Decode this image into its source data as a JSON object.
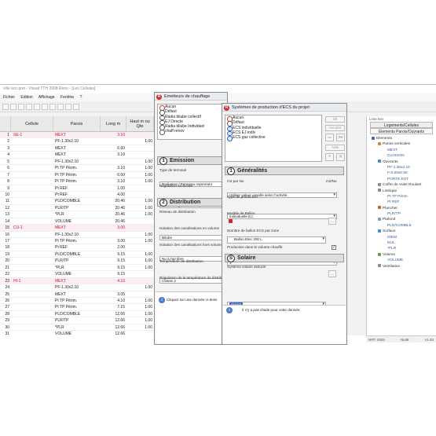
{
  "window": {
    "title": "ville eco.pret - Visual TTH 2008 Reno - [Les Cellules]"
  },
  "menu": [
    "Fichier",
    "Edition",
    "Affichage",
    "Fenêtre",
    "?"
  ],
  "grid": {
    "headers": {
      "cell": "Cellule",
      "wall": "Parois",
      "length": "Long m",
      "height": "Haut m ou Qte"
    },
    "rows": [
      {
        "num": "1",
        "cell": "SE-1",
        "wall": "MEXT",
        "len": "3.10",
        "h": "",
        "cellrow": true
      },
      {
        "num": "2",
        "cell": "",
        "wall": "PF-1.30x2.10",
        "len": "",
        "h": "1.00"
      },
      {
        "num": "3",
        "cell": "",
        "wall": "MEXT",
        "len": "6.60",
        "h": ""
      },
      {
        "num": "4",
        "cell": "",
        "wall": "MEXT",
        "len": "3.10",
        "h": ""
      },
      {
        "num": "5",
        "cell": "",
        "wall": "PF-1.30x2.10",
        "len": "",
        "h": "1.00"
      },
      {
        "num": "6",
        "cell": "",
        "wall": "Pt TP Périm.",
        "len": "3.10",
        "h": "1.00"
      },
      {
        "num": "7",
        "cell": "",
        "wall": "Pt TP Périm.",
        "len": "6.60",
        "h": "1.00"
      },
      {
        "num": "8",
        "cell": "",
        "wall": "Pt TP Périm.",
        "len": "3.10",
        "h": "1.00"
      },
      {
        "num": "9",
        "cell": "",
        "wall": "Pt REF",
        "len": "1.00",
        "h": ""
      },
      {
        "num": "10",
        "cell": "",
        "wall": "Pt REF",
        "len": "4.00",
        "h": ""
      },
      {
        "num": "11",
        "cell": "",
        "wall": "PLD/COMBLE",
        "len": "20.46",
        "h": "1.00"
      },
      {
        "num": "12",
        "cell": "",
        "wall": "PLR/TP",
        "len": "20.46",
        "h": "1.00"
      },
      {
        "num": "13",
        "cell": "",
        "wall": "*PLR",
        "len": "20.46",
        "h": "1.00"
      },
      {
        "num": "14",
        "cell": "",
        "wall": "VOLUME",
        "len": "20.46",
        "h": ""
      },
      {
        "num": "15",
        "cell": "CU-1",
        "wall": "MEXT",
        "len": "3.00",
        "h": "",
        "cellrow": true
      },
      {
        "num": "16",
        "cell": "",
        "wall": "PF-1.30x2.10",
        "len": "",
        "h": "1.00"
      },
      {
        "num": "17",
        "cell": "",
        "wall": "Pt TP Périm.",
        "len": "3.00",
        "h": "1.00"
      },
      {
        "num": "18",
        "cell": "",
        "wall": "Pt REF",
        "len": "2.00",
        "h": ""
      },
      {
        "num": "19",
        "cell": "",
        "wall": "PLD/COMBLE",
        "len": "9.15",
        "h": "1.00"
      },
      {
        "num": "20",
        "cell": "",
        "wall": "PLR/TP",
        "len": "9.15",
        "h": "1.00"
      },
      {
        "num": "21",
        "cell": "",
        "wall": "*PLR",
        "len": "9.15",
        "h": "1.00"
      },
      {
        "num": "22",
        "cell": "",
        "wall": "VOLUME",
        "len": "9.15",
        "h": ""
      },
      {
        "num": "23",
        "cell": "HI-1",
        "wall": "MEXT",
        "len": "4.10",
        "h": "",
        "cellrow": true
      },
      {
        "num": "24",
        "cell": "",
        "wall": "PF-1.30x2.10",
        "len": "",
        "h": "1.00"
      },
      {
        "num": "25",
        "cell": "",
        "wall": "MEXT",
        "len": "3.05",
        "h": ""
      },
      {
        "num": "26",
        "cell": "",
        "wall": "Pt TP Périm.",
        "len": "4.10",
        "h": "1.00"
      },
      {
        "num": "27",
        "cell": "",
        "wall": "Pt TP Périm.",
        "len": "7.15",
        "h": "1.00"
      },
      {
        "num": "28",
        "cell": "",
        "wall": "PLD/COMBLE",
        "len": "12.66",
        "h": "1.00"
      },
      {
        "num": "29",
        "cell": "",
        "wall": "PLR/TP",
        "len": "12.66",
        "h": "1.00"
      },
      {
        "num": "30",
        "cell": "",
        "wall": "*PLR",
        "len": "12.66",
        "h": "1.00"
      },
      {
        "num": "31",
        "cell": "",
        "wall": "VOLUME",
        "len": "12.66",
        "h": ""
      }
    ]
  },
  "emitters_dialog": {
    "title": "Emetteurs de chauffage",
    "list": [
      "Aucun",
      "Défaut",
      "Radia bliube collectif",
      "EJ Directe",
      "Radia bliube Individuel",
      "chaff renov"
    ],
    "emission": {
      "number": "1",
      "title": "Emission",
      "type_label": "Type de terminal",
      "type_value": "Radiateur / Panneau rayonnant",
      "reg_label": "Régulation terminale",
      "reg_value": "Aucune régulation terminale"
    },
    "distribution": {
      "number": "2",
      "title": "Distribution",
      "network_label": "Réseau de distribution",
      "network_value": "Bitube",
      "iso_vol_label": "Isolation des canalisations en volume",
      "iso_vol_value": "Nu à l'air libre",
      "iso_hv_label": "Isolation des canalisations hors volume",
      "iso_hv_value": "Classe 2",
      "temp_label": "Température de distribution",
      "temp_value": "Haute (traditionnel)",
      "reg_temp_label": "Régulation de la température de distribution",
      "reg_temp_value": "Régulation en fonction de la température"
    },
    "info": "Cliquez sur une donnée ci-dess"
  },
  "ecs_dialog": {
    "title": "Systèmes de production d'ECS du projet",
    "list": [
      "Aucun",
      "Défaut",
      "ECS individuelle",
      "ECS EJ indiv",
      "ECS gaz collective"
    ],
    "buttons": {
      "ok": "Ok",
      "cancel": "Annuler",
      "help": "Aide",
      "forward": ">>",
      "add": "+",
      "delete": "✕"
    },
    "generalites": {
      "number": "1",
      "title": "Généralités",
      "m2_label": "m2 par Nu",
      "m2_right": "m2/Nu",
      "m2_value": "Utiliser valeur unsolle selon l'activité",
      "prod_label": "Type de production",
      "prod_value": "Individuelle EJ",
      "model_label": "Modèle de Ballon",
      "model_value": "Ballon Elec 200 L",
      "nb_label": "Nombre de ballon ECS par zone",
      "nb_value": "1",
      "vol_label": "Production dans le volume chauffé",
      "vol_check": "✓"
    },
    "solaire": {
      "number": "S",
      "title": "Solaire",
      "sys_label": "Système solaire associé",
      "sys_value": "Aucun"
    },
    "info": "Il n'y a pas d'aide pour cette donnée."
  },
  "right_panel": {
    "title": "Liste Bar",
    "tab1": "Logements/Cellules",
    "tab2": "Elements Parois/Ouvrants",
    "tree": [
      {
        "label": "Elements",
        "level": 1,
        "color": "#3b67b5"
      },
      {
        "label": "Parois verticales",
        "level": 2,
        "color": "#d08a2a"
      },
      {
        "label": "MEXT",
        "level": 3,
        "color": ""
      },
      {
        "label": "CLOISON",
        "level": 3,
        "color": ""
      },
      {
        "label": "Ouvrants",
        "level": 2,
        "color": "#3b8fd0"
      },
      {
        "label": "PF-1.30x2.10",
        "level": 3,
        "color": ""
      },
      {
        "label": "F-0.50x0.50",
        "level": 3,
        "color": ""
      },
      {
        "label": "PORTE EXT",
        "level": 3,
        "color": ""
      },
      {
        "label": "Coffre de Volet Roulant",
        "level": 2,
        "color": "#8a8a8a"
      },
      {
        "label": "Linéique",
        "level": 2,
        "color": "#8a8a8a"
      },
      {
        "label": "Pt TP Périm.",
        "level": 3,
        "color": ""
      },
      {
        "label": "Pt REF",
        "level": 3,
        "color": ""
      },
      {
        "label": "Plancher",
        "level": 2,
        "color": "#c06a2a"
      },
      {
        "label": "PLR/TP",
        "level": 3,
        "color": ""
      },
      {
        "label": "Plafond",
        "level": 2,
        "color": "#7a9ac0"
      },
      {
        "label": "PLD/COMBLE",
        "level": 3,
        "color": ""
      },
      {
        "label": "Surface",
        "level": 2,
        "color": "#3b8fd0"
      },
      {
        "label": "IDEM",
        "level": 3,
        "color": ""
      },
      {
        "label": "NUL",
        "level": 3,
        "color": ""
      },
      {
        "label": "*PLR",
        "level": 3,
        "color": ""
      },
      {
        "label": "Volume",
        "level": 2,
        "color": "#6aa04a"
      },
      {
        "label": "VOLUME",
        "level": 3,
        "color": ""
      },
      {
        "label": "Ventilation",
        "level": 2,
        "color": "#8a8a8a"
      }
    ]
  },
  "statusbar": {
    "left": "NRT 2005",
    "mid": "NUM",
    "right": "v1.03"
  }
}
